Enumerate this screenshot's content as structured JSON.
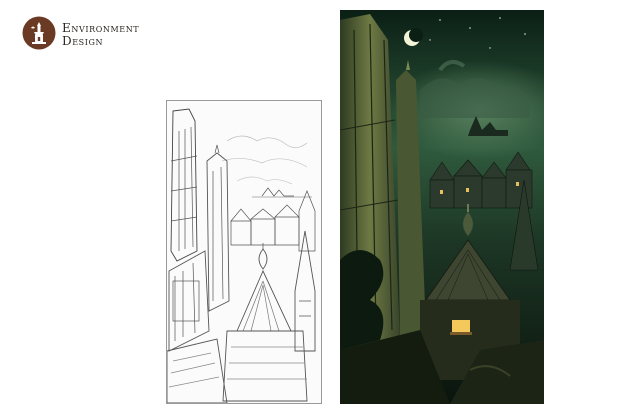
{
  "header": {
    "title_line1": "Environment",
    "title_line2": "Design"
  },
  "colors": {
    "logo_brown": "#6b3a24",
    "sky_dark": "#0e2418",
    "sky_green": "#3f6a4c",
    "window_glow": "#f4c85a"
  },
  "icons": {
    "logo": "bell-tower-logo-icon",
    "moon": "crescent-moon-icon"
  }
}
